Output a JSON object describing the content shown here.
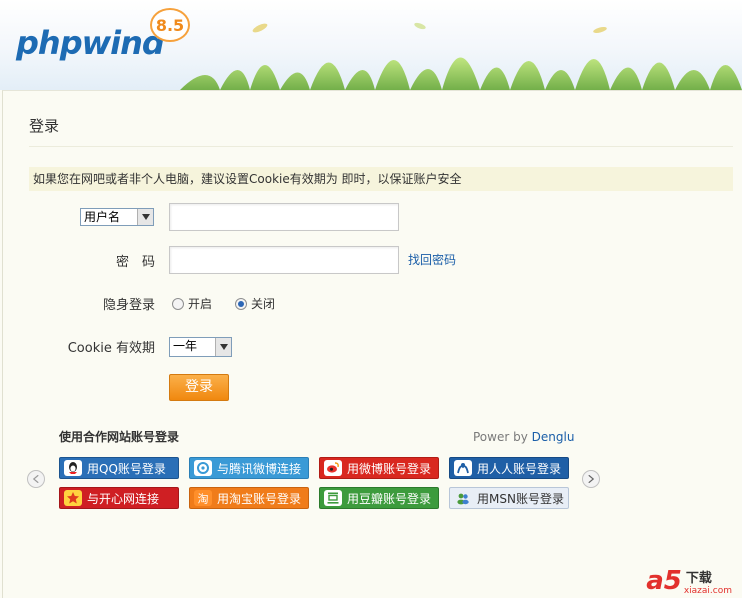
{
  "header": {
    "logo_text": "phpwind",
    "version": "8.5"
  },
  "page": {
    "title": "登录",
    "notice": "如果您在网吧或者非个人电脑，建议设置Cookie有效期为 即时，以保证账户安全"
  },
  "form": {
    "account_type": {
      "selected": "用户名"
    },
    "username": {
      "value": ""
    },
    "password": {
      "label": "密　码",
      "value": ""
    },
    "forgot_link": "找回密码",
    "stealth": {
      "label": "隐身登录",
      "options": [
        {
          "label": "开启",
          "checked": false
        },
        {
          "label": "关闭",
          "checked": true
        }
      ]
    },
    "cookie": {
      "label": "Cookie 有效期",
      "selected": "一年"
    },
    "submit_label": "登录"
  },
  "partners": {
    "title": "使用合作网站账号登录",
    "powered_prefix": "Power by ",
    "powered_brand": "Denglu",
    "items": [
      {
        "label": "用QQ账号登录",
        "icon": "qq-icon",
        "color": "#2a6fb7"
      },
      {
        "label": "与腾讯微博连接",
        "icon": "tencent-weibo-icon",
        "color": "#3a9ad6"
      },
      {
        "label": "用微博账号登录",
        "icon": "sina-weibo-icon",
        "color": "#d9281f"
      },
      {
        "label": "用人人账号登录",
        "icon": "renren-icon",
        "color": "#1f5fa6"
      },
      {
        "label": "与开心网连接",
        "icon": "kaixin-icon",
        "color": "#cf1f23"
      },
      {
        "label": "用淘宝账号登录",
        "icon": "taobao-icon",
        "color": "#f07c1a"
      },
      {
        "label": "用豆瓣账号登录",
        "icon": "douban-icon",
        "color": "#3d9b3d"
      },
      {
        "label": "用MSN账号登录",
        "icon": "msn-icon",
        "color": "#e8eef6"
      }
    ]
  },
  "watermark": {
    "brand": "a5",
    "suffix": "下载",
    "site": "xiazai.com"
  }
}
